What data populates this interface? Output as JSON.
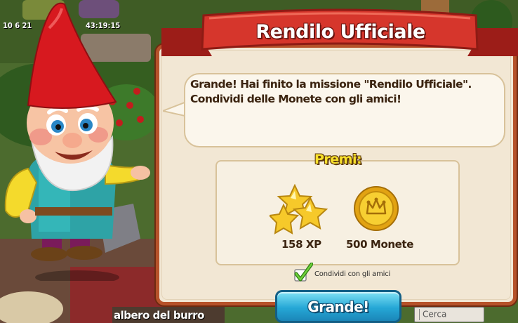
{
  "hud": {
    "timer_left": "10 6 21",
    "timer_mid": "43:19:15"
  },
  "bottom_bar": {
    "location_label": "albero del burro",
    "search_placeholder": "Cerca"
  },
  "dialog": {
    "title": "Rendilo Ufficiale",
    "message": "Grande! Hai finito la missione \"Rendilo Ufficiale\". Condividi delle Monete con gli amici!",
    "rewards_title": "Premi:",
    "rewards": [
      {
        "icon": "xp-stars-icon",
        "label": "158 XP"
      },
      {
        "icon": "gold-coin-icon",
        "label": "500 Monete"
      }
    ],
    "share_label": "Condividi con gli amici",
    "share_checked": true,
    "ok_button": "Grande!"
  },
  "colors": {
    "ribbon": "#c9322a",
    "dialog_border": "#b6522a",
    "button": "#25a7d6",
    "rewards_title": "#f7e02d"
  }
}
